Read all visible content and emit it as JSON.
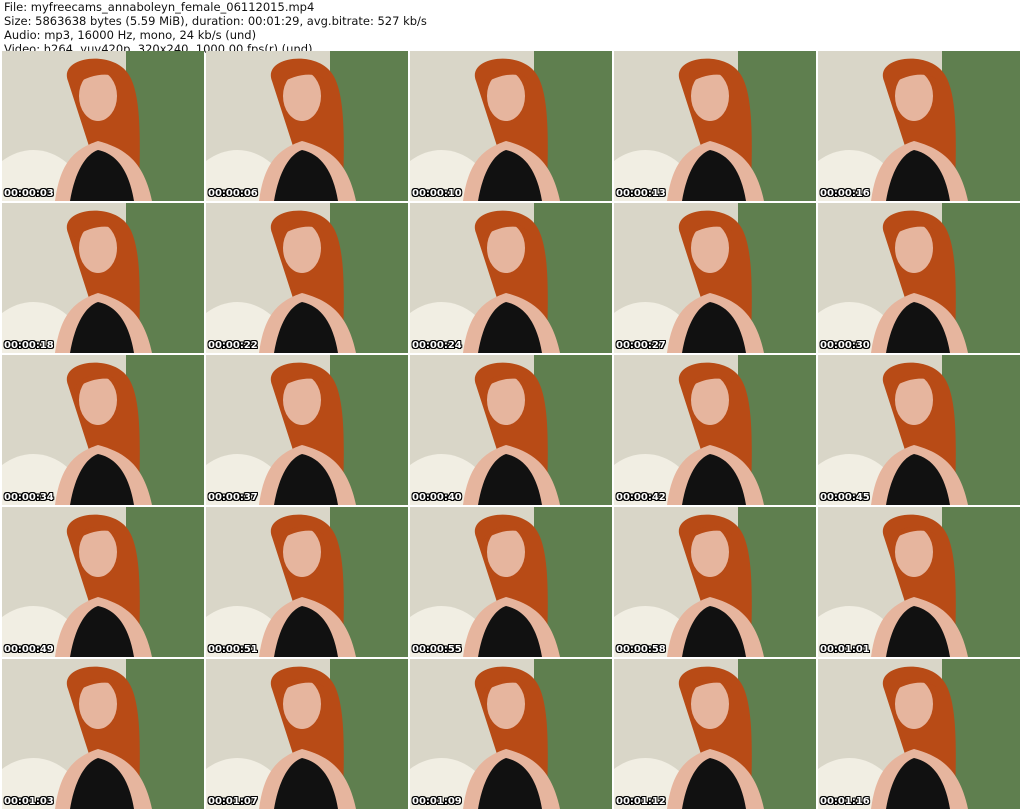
{
  "header": {
    "file": "File: myfreecams_annaboleyn_female_06112015.mp4",
    "size": "Size: 5863638 bytes (5.59 MiB), duration: 00:01:29, avg.bitrate: 527 kb/s",
    "audio": "Audio: mp3, 16000 Hz, mono, 24 kb/s (und)",
    "video": "Video: h264, yuv420p, 320x240, 1000.00 fps(r) (und)"
  },
  "timestamps": [
    "00:00:03",
    "00:00:06",
    "00:00:10",
    "00:00:13",
    "00:00:16",
    "00:00:18",
    "00:00:22",
    "00:00:24",
    "00:00:27",
    "00:00:30",
    "00:00:34",
    "00:00:37",
    "00:00:40",
    "00:00:42",
    "00:00:45",
    "00:00:49",
    "00:00:51",
    "00:00:55",
    "00:00:58",
    "00:01:01",
    "00:01:03",
    "00:01:07",
    "00:01:09",
    "00:01:12",
    "00:01:16"
  ],
  "colors": {
    "wall": "#d9d6c8",
    "curtain": "#5f7f4f",
    "hair": "#b84b16",
    "skin": "#e6b59e",
    "top": "#111111"
  }
}
